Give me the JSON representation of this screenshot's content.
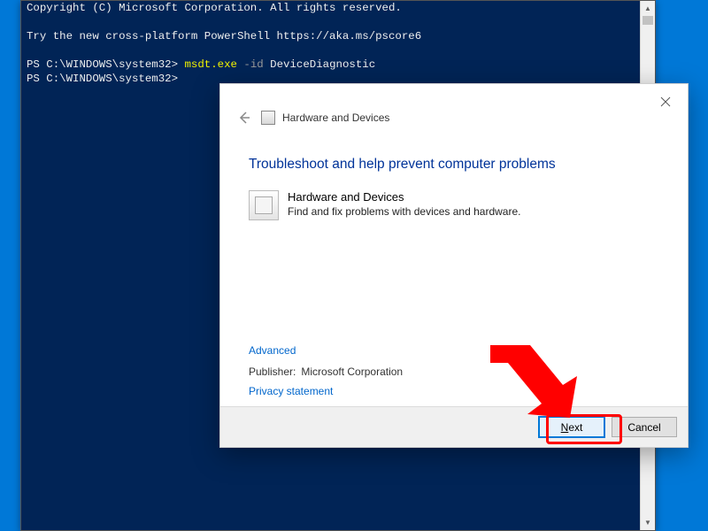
{
  "console": {
    "line1": "Copyright (C) Microsoft Corporation. All rights reserved.",
    "line2": "Try the new cross-platform PowerShell https://aka.ms/pscore6",
    "prompt1_prefix": "PS C:\\WINDOWS\\system32> ",
    "cmd_name": "msdt.exe",
    "cmd_flag": " -id ",
    "cmd_arg": "DeviceDiagnostic",
    "prompt2": "PS C:\\WINDOWS\\system32>"
  },
  "wizard": {
    "breadcrumb": "Hardware and Devices",
    "heading": "Troubleshoot and help prevent computer problems",
    "item_title": "Hardware and Devices",
    "item_desc": "Find and fix problems with devices and hardware.",
    "advanced": "Advanced",
    "publisher_label": "Publisher:",
    "publisher_value": "Microsoft Corporation",
    "privacy": "Privacy statement",
    "next_prefix": "N",
    "next_rest": "ext",
    "cancel": "Cancel"
  }
}
